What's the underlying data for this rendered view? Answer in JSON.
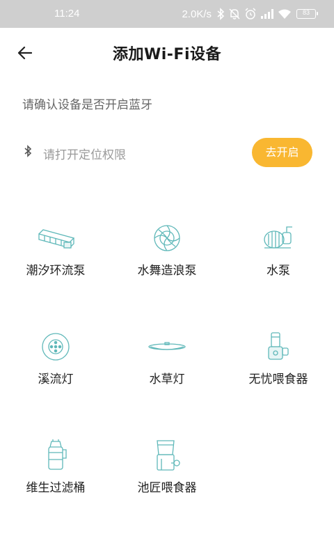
{
  "status_bar": {
    "time": "11:24",
    "network_speed": "2.0K/s",
    "battery": "83",
    "icons": [
      "bluetooth-icon",
      "mute-icon",
      "alarm-icon",
      "signal-icon",
      "wifi-icon",
      "battery-icon"
    ]
  },
  "header": {
    "title": "添加Wi-Fi设备",
    "back_icon": "back-arrow-icon"
  },
  "bluetooth_prompt": "请确认设备是否开启蓝牙",
  "location": {
    "icon": "bluetooth-icon",
    "text": "请打开定位权限",
    "button_label": "去开启"
  },
  "colors": {
    "accent": "#f9b731",
    "icon_teal": "#5fb8b9",
    "status_bar_bg": "#cfcfcf"
  },
  "devices": [
    {
      "label": "潮汐环流泵",
      "icon": "wave-pump-icon"
    },
    {
      "label": "水舞造浪泵",
      "icon": "wavemaker-icon"
    },
    {
      "label": "水泵",
      "icon": "water-pump-icon"
    },
    {
      "label": "溪流灯",
      "icon": "stream-light-icon"
    },
    {
      "label": "水草灯",
      "icon": "plant-light-icon"
    },
    {
      "label": "无忧喂食器",
      "icon": "auto-feeder-icon"
    },
    {
      "label": "维生过滤桶",
      "icon": "filter-canister-icon"
    },
    {
      "label": "池匠喂食器",
      "icon": "pond-feeder-icon"
    }
  ]
}
